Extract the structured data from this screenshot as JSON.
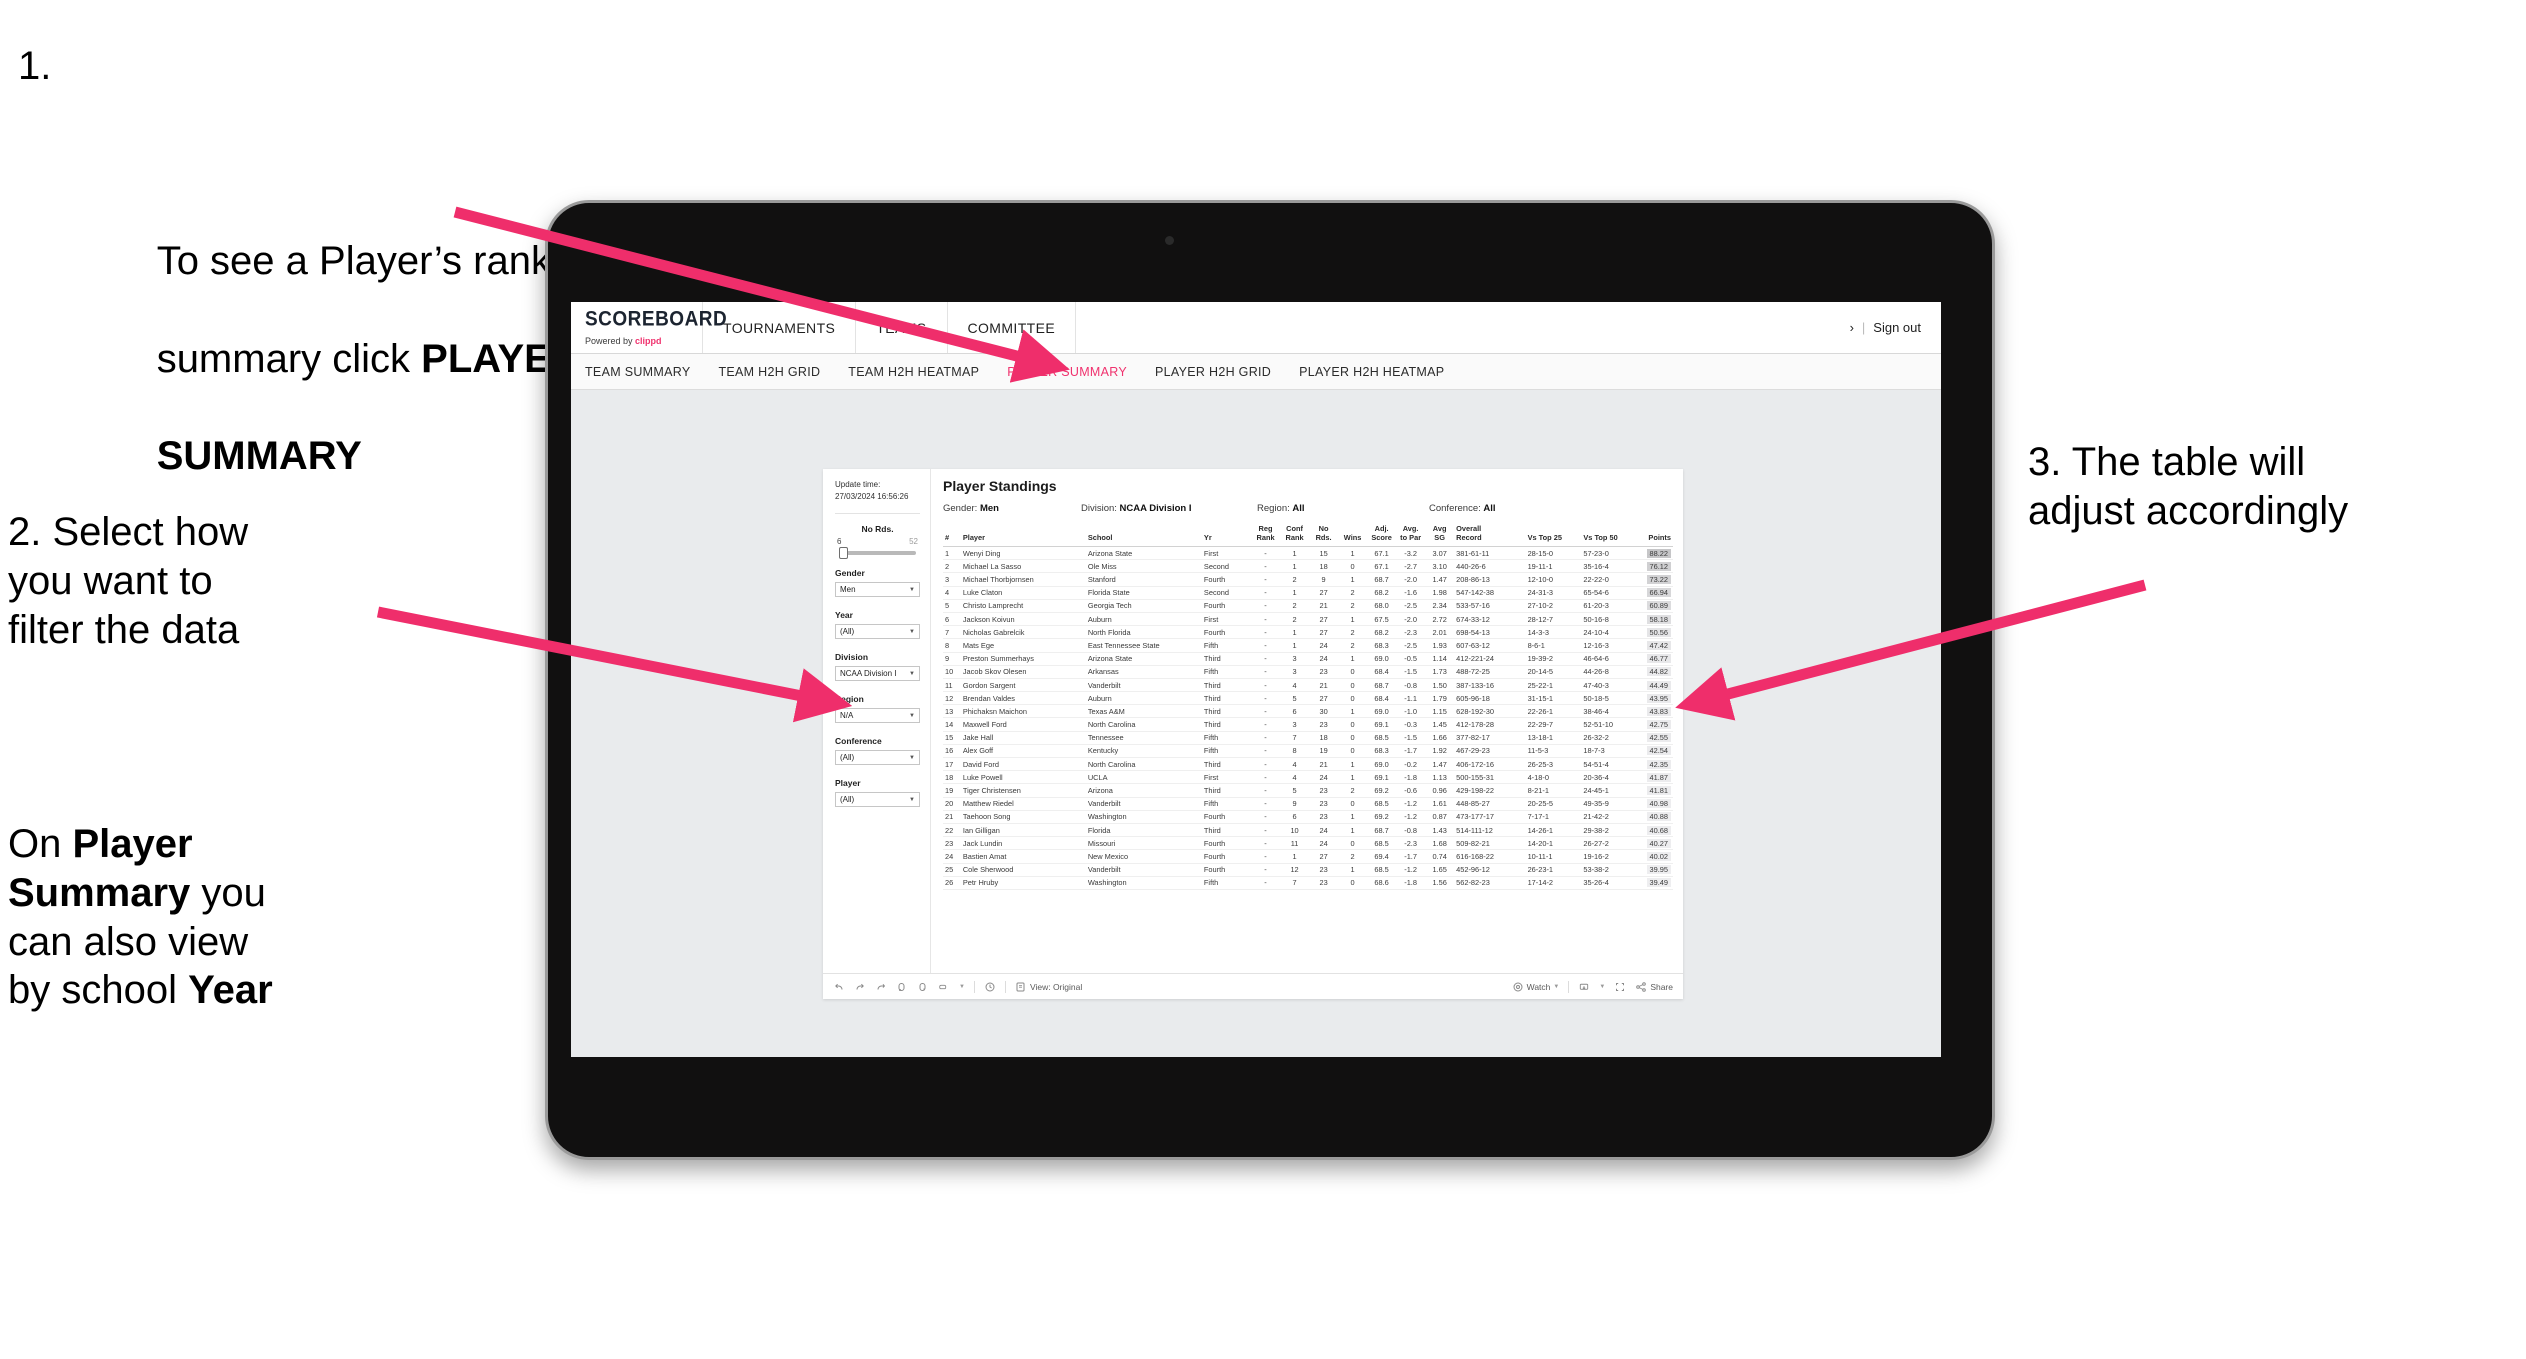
{
  "annotations": {
    "one": {
      "number": "1.",
      "line1": "To see a Player’s rankings",
      "line2_pre": "summary click ",
      "line2_bold": "PLAYER",
      "line3_bold": "SUMMARY"
    },
    "two_a": "2. Select how\nyou want to\nfilter the data",
    "two_b_pre": "On ",
    "two_b_bold1": "Player\nSummary",
    "two_b_mid": " you\ncan also view\nby school ",
    "two_b_bold2": "Year",
    "three": "3. The table will\nadjust accordingly"
  },
  "app": {
    "logo_main": "SCOREBOARD",
    "logo_sub_pre": "Powered by ",
    "logo_sub_brand": "clippd",
    "topnav": [
      {
        "label": "TOURNAMENTS"
      },
      {
        "label": "TEAMS"
      },
      {
        "label": "COMMITTEE"
      }
    ],
    "top_right": {
      "chevron": "›",
      "divider": "|",
      "sign_out": "Sign out"
    },
    "subnav": [
      {
        "label": "TEAM SUMMARY",
        "active": false
      },
      {
        "label": "TEAM H2H GRID",
        "active": false
      },
      {
        "label": "TEAM H2H HEATMAP",
        "active": false
      },
      {
        "label": "PLAYER SUMMARY",
        "active": true
      },
      {
        "label": "PLAYER H2H GRID",
        "active": false
      },
      {
        "label": "PLAYER H2H HEATMAP",
        "active": false
      }
    ],
    "accent_color": "#f0326e"
  },
  "filters": {
    "update_label": "Update time:",
    "update_value": "27/03/2024 16:56:26",
    "slider": {
      "title": "No Rds.",
      "min": "6",
      "max": "52"
    },
    "groups": [
      {
        "label": "Gender",
        "value": "Men"
      },
      {
        "label": "Year",
        "value": "(All)"
      },
      {
        "label": "Division",
        "value": "NCAA Division I"
      },
      {
        "label": "Region",
        "value": "N/A"
      },
      {
        "label": "Conference",
        "value": "(All)"
      },
      {
        "label": "Player",
        "value": "(All)"
      }
    ]
  },
  "dashboard": {
    "title": "Player Standings",
    "meta": [
      {
        "label": "Gender:",
        "value": "Men"
      },
      {
        "label": "Division:",
        "value": "NCAA Division I"
      },
      {
        "label": "Region:",
        "value": "All"
      },
      {
        "label": "Conference:",
        "value": "All"
      }
    ],
    "columns": [
      "#",
      "Player",
      "School",
      "Yr",
      "Reg\nRank",
      "Conf\nRank",
      "No\nRds.",
      "Wins",
      "Adj.\nScore",
      "Avg.\nto Par",
      "Avg\nSG",
      "Overall\nRecord",
      "Vs Top 25",
      "Vs Top 50",
      "Points"
    ],
    "rows": [
      [
        "1",
        "Wenyi Ding",
        "Arizona State",
        "First",
        "-",
        "1",
        "15",
        "1",
        "67.1",
        "-3.2",
        "3.07",
        "381-61-11",
        "28-15-0",
        "57-23-0",
        "88.22"
      ],
      [
        "2",
        "Michael La Sasso",
        "Ole Miss",
        "Second",
        "-",
        "1",
        "18",
        "0",
        "67.1",
        "-2.7",
        "3.10",
        "440-26-6",
        "19-11-1",
        "35-16-4",
        "76.12"
      ],
      [
        "3",
        "Michael Thorbjornsen",
        "Stanford",
        "Fourth",
        "-",
        "2",
        "9",
        "1",
        "68.7",
        "-2.0",
        "1.47",
        "208-86-13",
        "12-10-0",
        "22-22-0",
        "73.22"
      ],
      [
        "4",
        "Luke Claton",
        "Florida State",
        "Second",
        "-",
        "1",
        "27",
        "2",
        "68.2",
        "-1.6",
        "1.98",
        "547-142-38",
        "24-31-3",
        "65-54-6",
        "66.94"
      ],
      [
        "5",
        "Christo Lamprecht",
        "Georgia Tech",
        "Fourth",
        "-",
        "2",
        "21",
        "2",
        "68.0",
        "-2.5",
        "2.34",
        "533-57-16",
        "27-10-2",
        "61-20-3",
        "60.89"
      ],
      [
        "6",
        "Jackson Koivun",
        "Auburn",
        "First",
        "-",
        "2",
        "27",
        "1",
        "67.5",
        "-2.0",
        "2.72",
        "674-33-12",
        "28-12-7",
        "50-16-8",
        "58.18"
      ],
      [
        "7",
        "Nicholas Gabrelcik",
        "North Florida",
        "Fourth",
        "-",
        "1",
        "27",
        "2",
        "68.2",
        "-2.3",
        "2.01",
        "698-54-13",
        "14-3-3",
        "24-10-4",
        "50.56"
      ],
      [
        "8",
        "Mats Ege",
        "East Tennessee State",
        "Fifth",
        "-",
        "1",
        "24",
        "2",
        "68.3",
        "-2.5",
        "1.93",
        "607-63-12",
        "8-6-1",
        "12-16-3",
        "47.42"
      ],
      [
        "9",
        "Preston Summerhays",
        "Arizona State",
        "Third",
        "-",
        "3",
        "24",
        "1",
        "69.0",
        "-0.5",
        "1.14",
        "412-221-24",
        "19-39-2",
        "46-64-6",
        "46.77"
      ],
      [
        "10",
        "Jacob Skov Olesen",
        "Arkansas",
        "Fifth",
        "-",
        "3",
        "23",
        "0",
        "68.4",
        "-1.5",
        "1.73",
        "488-72-25",
        "20-14-5",
        "44-26-8",
        "44.82"
      ],
      [
        "11",
        "Gordon Sargent",
        "Vanderbilt",
        "Third",
        "-",
        "4",
        "21",
        "0",
        "68.7",
        "-0.8",
        "1.50",
        "387-133-16",
        "25-22-1",
        "47-40-3",
        "44.49"
      ],
      [
        "12",
        "Brendan Valdes",
        "Auburn",
        "Third",
        "-",
        "5",
        "27",
        "0",
        "68.4",
        "-1.1",
        "1.79",
        "605-96-18",
        "31-15-1",
        "50-18-5",
        "43.95"
      ],
      [
        "13",
        "Phichaksn Maichon",
        "Texas A&M",
        "Third",
        "-",
        "6",
        "30",
        "1",
        "69.0",
        "-1.0",
        "1.15",
        "628-192-30",
        "22-26-1",
        "38-46-4",
        "43.83"
      ],
      [
        "14",
        "Maxwell Ford",
        "North Carolina",
        "Third",
        "-",
        "3",
        "23",
        "0",
        "69.1",
        "-0.3",
        "1.45",
        "412-178-28",
        "22-29-7",
        "52-51-10",
        "42.75"
      ],
      [
        "15",
        "Jake Hall",
        "Tennessee",
        "Fifth",
        "-",
        "7",
        "18",
        "0",
        "68.5",
        "-1.5",
        "1.66",
        "377-82-17",
        "13-18-1",
        "26-32-2",
        "42.55"
      ],
      [
        "16",
        "Alex Goff",
        "Kentucky",
        "Fifth",
        "-",
        "8",
        "19",
        "0",
        "68.3",
        "-1.7",
        "1.92",
        "467-29-23",
        "11-5-3",
        "18-7-3",
        "42.54"
      ],
      [
        "17",
        "David Ford",
        "North Carolina",
        "Third",
        "-",
        "4",
        "21",
        "1",
        "69.0",
        "-0.2",
        "1.47",
        "406-172-16",
        "26-25-3",
        "54-51-4",
        "42.35"
      ],
      [
        "18",
        "Luke Powell",
        "UCLA",
        "First",
        "-",
        "4",
        "24",
        "1",
        "69.1",
        "-1.8",
        "1.13",
        "500-155-31",
        "4-18-0",
        "20-36-4",
        "41.87"
      ],
      [
        "19",
        "Tiger Christensen",
        "Arizona",
        "Third",
        "-",
        "5",
        "23",
        "2",
        "69.2",
        "-0.6",
        "0.96",
        "429-198-22",
        "8-21-1",
        "24-45-1",
        "41.81"
      ],
      [
        "20",
        "Matthew Riedel",
        "Vanderbilt",
        "Fifth",
        "-",
        "9",
        "23",
        "0",
        "68.5",
        "-1.2",
        "1.61",
        "448-85-27",
        "20-25-5",
        "49-35-9",
        "40.98"
      ],
      [
        "21",
        "Taehoon Song",
        "Washington",
        "Fourth",
        "-",
        "6",
        "23",
        "1",
        "69.2",
        "-1.2",
        "0.87",
        "473-177-17",
        "7-17-1",
        "21-42-2",
        "40.88"
      ],
      [
        "22",
        "Ian Gilligan",
        "Florida",
        "Third",
        "-",
        "10",
        "24",
        "1",
        "68.7",
        "-0.8",
        "1.43",
        "514-111-12",
        "14-26-1",
        "29-38-2",
        "40.68"
      ],
      [
        "23",
        "Jack Lundin",
        "Missouri",
        "Fourth",
        "-",
        "11",
        "24",
        "0",
        "68.5",
        "-2.3",
        "1.68",
        "509-82-21",
        "14-20-1",
        "26-27-2",
        "40.27"
      ],
      [
        "24",
        "Bastien Amat",
        "New Mexico",
        "Fourth",
        "-",
        "1",
        "27",
        "2",
        "69.4",
        "-1.7",
        "0.74",
        "616-168-22",
        "10-11-1",
        "19-16-2",
        "40.02"
      ],
      [
        "25",
        "Cole Sherwood",
        "Vanderbilt",
        "Fourth",
        "-",
        "12",
        "23",
        "1",
        "68.5",
        "-1.2",
        "1.65",
        "452-96-12",
        "26-23-1",
        "53-38-2",
        "39.95"
      ],
      [
        "26",
        "Petr Hruby",
        "Washington",
        "Fifth",
        "-",
        "7",
        "23",
        "0",
        "68.6",
        "-1.8",
        "1.56",
        "562-82-23",
        "17-14-2",
        "35-26-4",
        "39.49"
      ]
    ]
  },
  "toolbar": {
    "view_label": "View: Original",
    "watch_label": "Watch",
    "share_label": "Share"
  }
}
